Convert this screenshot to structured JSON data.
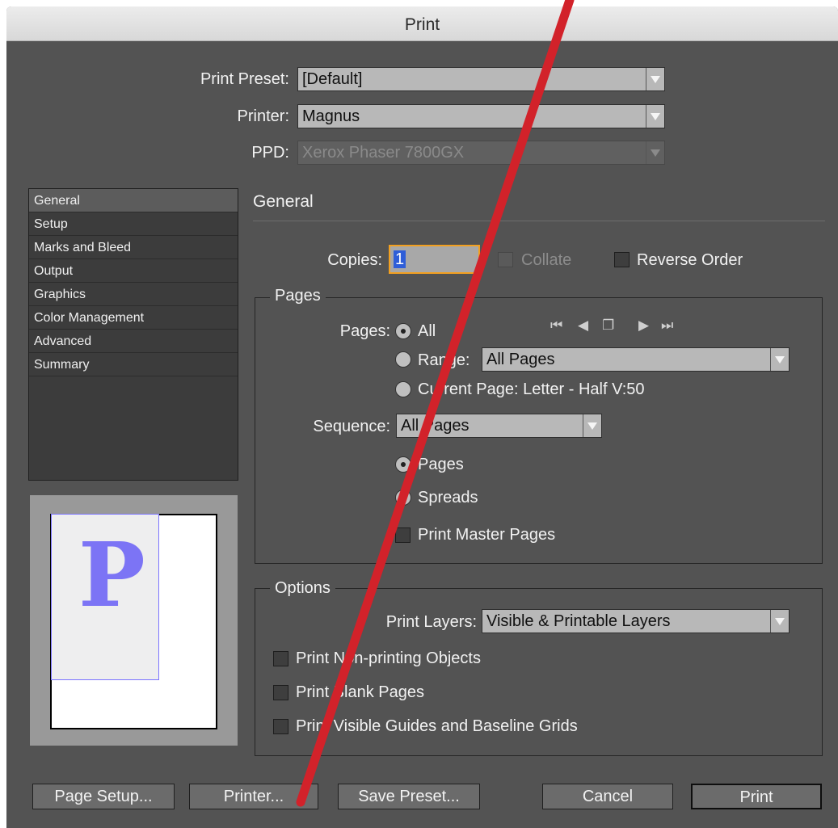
{
  "window": {
    "title": "Print"
  },
  "top": {
    "print_preset_label": "Print Preset:",
    "print_preset_value": "[Default]",
    "printer_label": "Printer:",
    "printer_value": "Magnus",
    "ppd_label": "PPD:",
    "ppd_value": "Xerox Phaser 7800GX"
  },
  "sidebar": {
    "items": [
      {
        "label": "General"
      },
      {
        "label": "Setup"
      },
      {
        "label": "Marks and Bleed"
      },
      {
        "label": "Output"
      },
      {
        "label": "Graphics"
      },
      {
        "label": "Color Management"
      },
      {
        "label": "Advanced"
      },
      {
        "label": "Summary"
      }
    ],
    "selected": "General"
  },
  "preview": {
    "glyph": "P"
  },
  "general": {
    "title": "General",
    "copies_label": "Copies:",
    "copies_value": "1",
    "collate_label": "Collate",
    "reverse_order_label": "Reverse Order"
  },
  "pages": {
    "legend": "Pages",
    "pages_label": "Pages:",
    "all_label": "All",
    "range_label": "Range:",
    "range_value": "All Pages",
    "current_page_label": "Current Page: Letter - Half V:50",
    "sequence_label": "Sequence:",
    "sequence_value": "All Pages",
    "pages_option": "Pages",
    "spreads_option": "Spreads",
    "print_master_pages": "Print Master Pages"
  },
  "options": {
    "legend": "Options",
    "print_layers_label": "Print Layers:",
    "print_layers_value": "Visible & Printable Layers",
    "non_printing": "Print Non-printing Objects",
    "blank_pages": "Print Blank Pages",
    "guides": "Print Visible Guides and Baseline Grids"
  },
  "buttons": {
    "page_setup": "Page Setup...",
    "printer": "Printer...",
    "save_preset": "Save Preset...",
    "cancel": "Cancel",
    "print": "Print"
  },
  "icons": {
    "first_page": "first-page-icon",
    "prev_page": "prev-page-icon",
    "spread": "spread-icon",
    "next_page": "next-page-icon",
    "last_page": "last-page-icon"
  },
  "colors": {
    "focus_ring": "#f2a020",
    "annotation_stroke": "#d2222a",
    "preview_glyph": "#7c74f5"
  }
}
